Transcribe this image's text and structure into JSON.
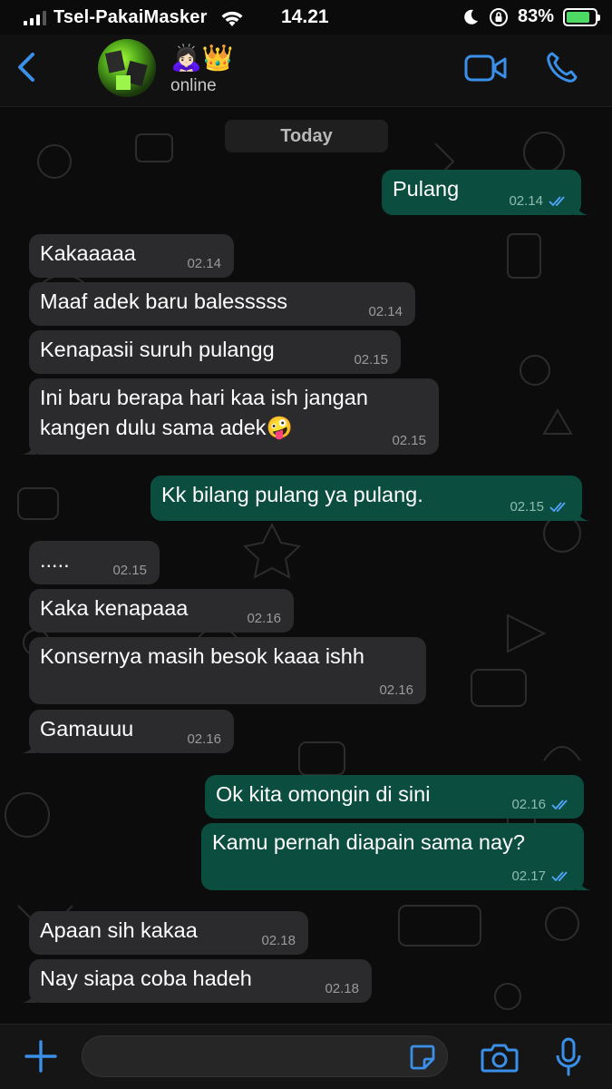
{
  "status_bar": {
    "carrier": "Tsel-PakaiMasker",
    "time": "14.21",
    "battery_percent": "83%",
    "battery_level": 0.83,
    "icons": [
      "signal-icon",
      "wifi-icon",
      "moon-icon",
      "rotation-lock-icon",
      "battery-charging-icon"
    ]
  },
  "header": {
    "contact_name_emoji": "🙇🏻‍♀️👑",
    "status": "online",
    "icons": [
      "back-chevron-icon",
      "video-call-icon",
      "phone-call-icon"
    ]
  },
  "chat": {
    "date_separator": "Today",
    "messages": [
      {
        "dir": "out",
        "text": "Pulang",
        "time": "02.14",
        "read": true
      },
      {
        "dir": "in",
        "text": "Kakaaaaa",
        "time": "02.14"
      },
      {
        "dir": "in",
        "text": "Maaf adek baru balesssss",
        "time": "02.14"
      },
      {
        "dir": "in",
        "text": "Kenapasii suruh pulangg",
        "time": "02.15"
      },
      {
        "dir": "in",
        "text": "Ini baru berapa hari kaa ish jangan kangen dulu sama adek🤪",
        "time": "02.15"
      },
      {
        "dir": "out",
        "text": "Kk bilang pulang ya pulang.",
        "time": "02.15",
        "read": true
      },
      {
        "dir": "in",
        "text": ".....",
        "time": "02.15"
      },
      {
        "dir": "in",
        "text": "Kaka kenapaaa",
        "time": "02.16"
      },
      {
        "dir": "in",
        "text": "Konsernya masih besok kaaa ishh",
        "time": "02.16"
      },
      {
        "dir": "in",
        "text": "Gamauuu",
        "time": "02.16"
      },
      {
        "dir": "out",
        "text": "Ok kita omongin di sini",
        "time": "02.16",
        "read": true
      },
      {
        "dir": "out",
        "text": "Kamu pernah diapain sama nay?",
        "time": "02.17",
        "read": true
      },
      {
        "dir": "in",
        "text": "Apaan sih kakaa",
        "time": "02.18"
      },
      {
        "dir": "in",
        "text": "Nay siapa coba hadeh",
        "time": "02.18"
      }
    ]
  },
  "input_bar": {
    "placeholder": "",
    "icons": [
      "plus-icon",
      "sticker-icon",
      "camera-icon",
      "microphone-icon"
    ]
  },
  "colors": {
    "accent": "#3a8fe8",
    "incoming_bubble": "#2b2b2d",
    "outgoing_bubble": "#0b4d3f",
    "read_ticks": "#53a6ff"
  }
}
